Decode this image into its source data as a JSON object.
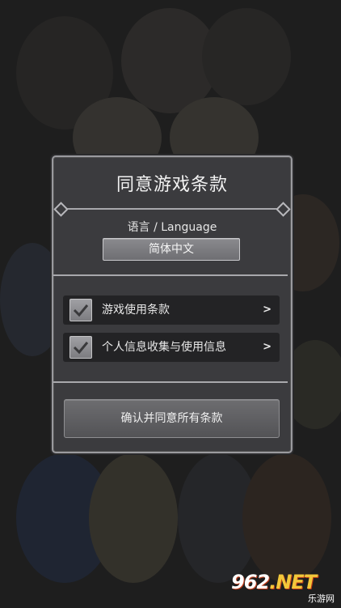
{
  "dialog": {
    "title": "同意游戏条款",
    "language_label": "语言 / Language",
    "language_value": "简体中文",
    "terms": [
      {
        "label": "游戏使用条款",
        "checked": true,
        "chevron": ">"
      },
      {
        "label": "个人信息收集与使用信息",
        "checked": true,
        "chevron": ">"
      }
    ],
    "confirm_label": "确认并同意所有条款"
  },
  "watermark": {
    "logo": "962",
    "logo_suffix": ".NET",
    "subtitle": "乐游网"
  },
  "colors": {
    "panel": "#3b3b3e",
    "border": "#9a9a9e",
    "row": "#232325",
    "text": "#e8e8e8"
  },
  "icons": [
    "checkmark-icon",
    "chevron-right-icon",
    "diamond-ornament-icon"
  ]
}
